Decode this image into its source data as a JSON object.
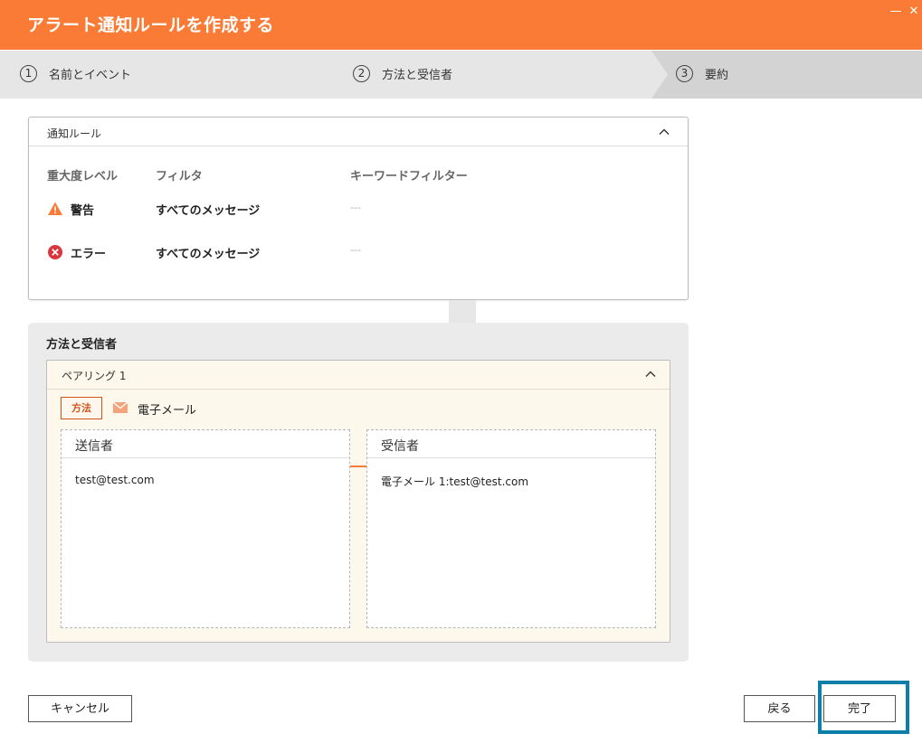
{
  "window": {
    "title": "アラート通知ルールを作成する"
  },
  "stepper": {
    "steps": [
      {
        "number": "1",
        "label": "名前とイベント"
      },
      {
        "number": "2",
        "label": "方法と受信者"
      },
      {
        "number": "3",
        "label": "要約"
      }
    ],
    "active_step": 3
  },
  "rules_panel": {
    "title": "通知ルール",
    "columns": [
      "重大度レベル",
      "フィルタ",
      "キーワードフィルター"
    ],
    "rows": [
      {
        "severity": "警告",
        "severity_icon": "warning-triangle-icon",
        "filter": "すべてのメッセージ",
        "keyword": "---"
      },
      {
        "severity": "エラー",
        "severity_icon": "error-circle-icon",
        "filter": "すべてのメッセージ",
        "keyword": "---"
      }
    ]
  },
  "method_section": {
    "title": "方法と受信者",
    "pairing": {
      "title": "ペアリング 1",
      "method_tag": "方法",
      "method_icon": "mail-icon",
      "method_name": "電子メール",
      "sender": {
        "header": "送信者",
        "value": "test@test.com"
      },
      "recipient": {
        "header": "受信者",
        "value": "電子メール 1:test@test.com"
      }
    }
  },
  "footer": {
    "cancel_label": "キャンセル",
    "back_label": "戻る",
    "done_label": "完了"
  },
  "colors": {
    "accent": "#f97b35",
    "warning": "#f97b35",
    "error": "#d9363e",
    "focus": "#0b7fa8"
  }
}
